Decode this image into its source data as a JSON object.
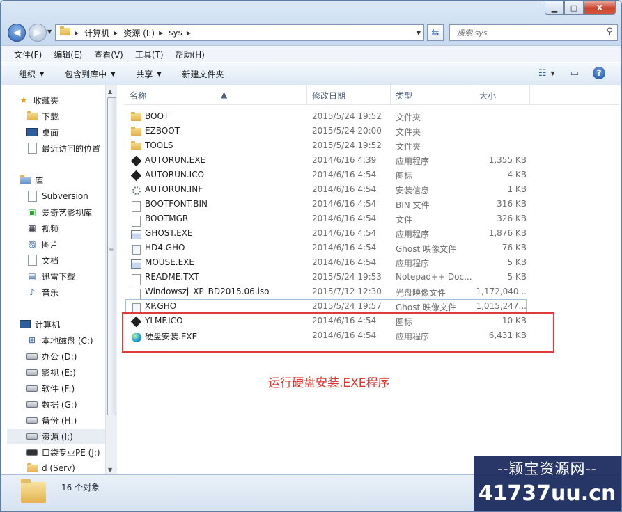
{
  "window": {
    "caption_buttons": {
      "minimize": "▁",
      "maximize": "□",
      "close": "X"
    }
  },
  "address_bar": {
    "crumbs": [
      "计算机",
      "资源 (I:)",
      "sys"
    ]
  },
  "search": {
    "placeholder": "搜索 sys"
  },
  "menu": [
    "文件(F)",
    "编辑(E)",
    "查看(V)",
    "工具(T)",
    "帮助(H)"
  ],
  "toolbar": {
    "organize": "组织",
    "include_library": "包含到库中",
    "share": "共享",
    "new_folder": "新建文件夹"
  },
  "nav": {
    "favorites": {
      "label": "收藏夹",
      "items": [
        "下载",
        "桌面",
        "最近访问的位置"
      ]
    },
    "libraries": {
      "label": "库",
      "items": [
        "Subversion",
        "爱奇艺影视库",
        "视频",
        "图片",
        "文档",
        "迅雷下载",
        "音乐"
      ]
    },
    "computer": {
      "label": "计算机",
      "items": [
        "本地磁盘 (C:)",
        "办公 (D:)",
        "影视 (E:)",
        "软件 (F:)",
        "数据 (G:)",
        "备份 (H:)",
        "资源 (I:)",
        "口袋专业PE (J:)",
        "d (Serv)"
      ]
    }
  },
  "columns": {
    "name": "名称",
    "date": "修改日期",
    "type": "类型",
    "size": "大小"
  },
  "files": [
    {
      "name": "BOOT",
      "date": "2015/5/24 19:52",
      "type": "文件夹",
      "size": "",
      "icon": "folder-icon"
    },
    {
      "name": "EZBOOT",
      "date": "2015/5/24 20:00",
      "type": "文件夹",
      "size": "",
      "icon": "folder-icon"
    },
    {
      "name": "TOOLS",
      "date": "2015/5/24 19:52",
      "type": "文件夹",
      "size": "",
      "icon": "folder-icon"
    },
    {
      "name": "AUTORUN.EXE",
      "date": "2014/6/16 4:39",
      "type": "应用程序",
      "size": "1,355 KB",
      "icon": "diamond-icon"
    },
    {
      "name": "AUTORUN.ICO",
      "date": "2014/6/16 4:54",
      "type": "图标",
      "size": "4 KB",
      "icon": "diamond-icon"
    },
    {
      "name": "AUTORUN.INF",
      "date": "2014/6/16 4:54",
      "type": "安装信息",
      "size": "1 KB",
      "icon": "settings-file-icon"
    },
    {
      "name": "BOOTFONT.BIN",
      "date": "2014/6/16 4:54",
      "type": "BIN 文件",
      "size": "316 KB",
      "icon": "blank-file-icon"
    },
    {
      "name": "BOOTMGR",
      "date": "2014/6/16 4:54",
      "type": "文件",
      "size": "326 KB",
      "icon": "blank-file-icon"
    },
    {
      "name": "GHOST.EXE",
      "date": "2014/6/16 4:54",
      "type": "应用程序",
      "size": "1,876 KB",
      "icon": "exe-icon"
    },
    {
      "name": "HD4.GHO",
      "date": "2014/6/16 4:54",
      "type": "Ghost 映像文件",
      "size": "76 KB",
      "icon": "ghost-file-icon"
    },
    {
      "name": "MOUSE.EXE",
      "date": "2014/6/16 4:54",
      "type": "应用程序",
      "size": "5 KB",
      "icon": "exe-icon"
    },
    {
      "name": "README.TXT",
      "date": "2015/5/24 19:53",
      "type": "Notepad++ Doc...",
      "size": "5 KB",
      "icon": "text-file-icon"
    },
    {
      "name": "Windowszj_XP_BD2015.06.iso",
      "date": "2015/7/12 12:30",
      "type": "光盘映像文件",
      "size": "1,172,040...",
      "icon": "iso-file-icon"
    },
    {
      "name": "XP.GHO",
      "date": "2015/5/24 19:57",
      "type": "Ghost 映像文件",
      "size": "1,015,247...",
      "icon": "ghost-file-icon"
    },
    {
      "name": "YLMF.ICO",
      "date": "2014/6/16 4:54",
      "type": "图标",
      "size": "10 KB",
      "icon": "diamond-icon"
    },
    {
      "name": "硬盘安装.EXE",
      "date": "2014/6/16 4:54",
      "type": "应用程序",
      "size": "6,431 KB",
      "icon": "installer-icon"
    }
  ],
  "annotation": "运行硬盘安装.EXE程序",
  "status": {
    "count": "16 个对象"
  },
  "watermark": {
    "line1": "--颖宝资源网--",
    "line2": "41737uu.cn"
  },
  "colors": {
    "annotation_red": "#e03a3a",
    "selection": "#e8edf3"
  }
}
